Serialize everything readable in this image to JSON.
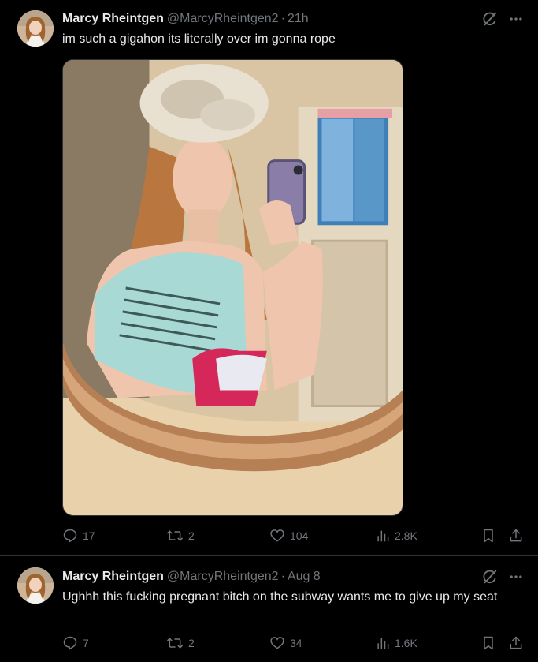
{
  "colors": {
    "background": "#000000",
    "text": "#e7e9ea",
    "muted": "#71767b",
    "divider": "#2f3336"
  },
  "tweets": [
    {
      "author_name": "Marcy Rheintgen",
      "handle": "@MarcyRheintgen2",
      "separator": "·",
      "time": "21h",
      "text": "im such a gigahon its literally over im gonna rope",
      "media": "mirror-selfie-photo",
      "actions": {
        "replies": "17",
        "reposts": "2",
        "likes": "104",
        "views": "2.8K"
      }
    },
    {
      "author_name": "Marcy Rheintgen",
      "handle": "@MarcyRheintgen2",
      "separator": "·",
      "time": "Aug 8",
      "text": "Ughhh this fucking pregnant bitch on the subway wants me to give up my seat",
      "actions": {
        "replies": "7",
        "reposts": "2",
        "likes": "34",
        "views": "1.6K"
      }
    }
  ],
  "icons": [
    "grok-icon",
    "more-icon",
    "reply-icon",
    "repost-icon",
    "like-icon",
    "views-icon",
    "bookmark-icon",
    "share-icon"
  ]
}
